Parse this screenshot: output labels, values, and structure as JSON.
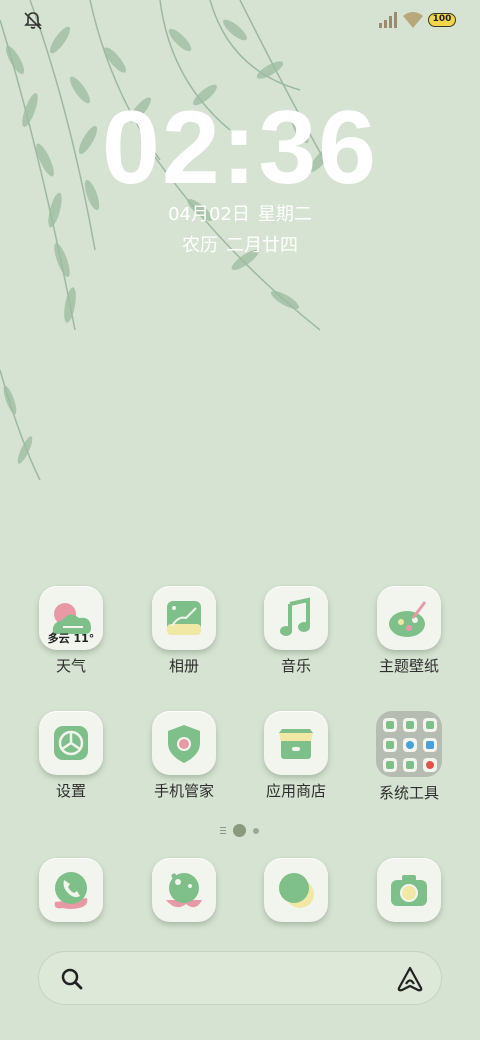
{
  "status_bar": {
    "mute_icon": "bell-muted-icon",
    "signal_icon": "signal-bars-icon",
    "wifi_icon": "wifi-icon",
    "battery_level": "100"
  },
  "lock": {
    "time": "02:36",
    "date": "04月02日",
    "weekday": "星期二",
    "lunar_label": "农历",
    "lunar_date": "二月廿四"
  },
  "apps_row1": [
    {
      "label": "天气",
      "icon": "weather-cloud-icon",
      "badge_text": "多云 11°"
    },
    {
      "label": "相册",
      "icon": "gallery-icon"
    },
    {
      "label": "音乐",
      "icon": "music-note-icon"
    },
    {
      "label": "主题壁纸",
      "icon": "palette-icon"
    }
  ],
  "apps_row2": [
    {
      "label": "设置",
      "icon": "settings-icon"
    },
    {
      "label": "手机管家",
      "icon": "shield-icon"
    },
    {
      "label": "应用商店",
      "icon": "store-icon"
    },
    {
      "label": "系统工具",
      "icon": "folder-icon"
    }
  ],
  "dock": [
    {
      "icon": "phone-icon"
    },
    {
      "icon": "browser-planet-icon"
    },
    {
      "icon": "messages-icon"
    },
    {
      "icon": "camera-icon"
    }
  ],
  "page_indicator": {
    "pages": 2,
    "current": 1
  },
  "search": {
    "icon": "search-icon",
    "assistant_icon": "assistant-icon"
  },
  "colors": {
    "background": "#d6e3d2",
    "icon_green": "#7fbf8a",
    "icon_pink": "#e79aa6",
    "icon_yellow": "#f1e8a6",
    "folder_bg": "#b7bcb2"
  }
}
